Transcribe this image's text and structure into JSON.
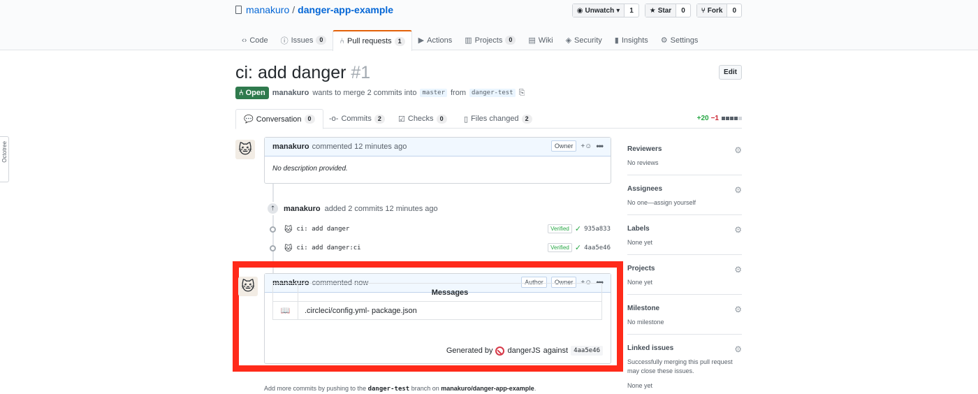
{
  "repo": {
    "owner": "manakuro",
    "separator": "/",
    "name": "danger-app-example"
  },
  "repo_actions": [
    {
      "label": "Unwatch",
      "icon": "eye-icon",
      "count": "1"
    },
    {
      "label": "Star",
      "icon": "star-icon",
      "count": "0"
    },
    {
      "label": "Fork",
      "icon": "fork-icon",
      "count": "0"
    }
  ],
  "repo_nav": [
    {
      "label": "Code",
      "icon": "code-icon",
      "count": ""
    },
    {
      "label": "Issues",
      "icon": "issue-icon",
      "count": "0"
    },
    {
      "label": "Pull requests",
      "icon": "pull-request-icon",
      "count": "1",
      "active": true
    },
    {
      "label": "Actions",
      "icon": "play-icon",
      "count": ""
    },
    {
      "label": "Projects",
      "icon": "project-icon",
      "count": "0"
    },
    {
      "label": "Wiki",
      "icon": "book-icon",
      "count": ""
    },
    {
      "label": "Security",
      "icon": "shield-icon",
      "count": ""
    },
    {
      "label": "Insights",
      "icon": "graph-icon",
      "count": ""
    },
    {
      "label": "Settings",
      "icon": "gear-icon",
      "count": ""
    }
  ],
  "pr": {
    "title": "ci: add danger",
    "number": "#1",
    "edit_label": "Edit",
    "state": "Open",
    "author": "manakuro",
    "merge_text": "wants to merge 2 commits into",
    "base": "master",
    "from_text": "from",
    "head": "danger-test"
  },
  "pr_tabs": [
    {
      "label": "Conversation",
      "count": "0",
      "icon": "comment-icon",
      "active": true
    },
    {
      "label": "Commits",
      "count": "2",
      "icon": "commit-icon"
    },
    {
      "label": "Checks",
      "count": "0",
      "icon": "checklist-icon"
    },
    {
      "label": "Files changed",
      "count": "2",
      "icon": "file-diff-icon"
    }
  ],
  "diffstat": {
    "additions": "+20",
    "deletions": "−1"
  },
  "outline_label": "Octotree",
  "comment1": {
    "author": "manakuro",
    "action": "commented 12 minutes ago",
    "role": "Owner",
    "body": "No description provided."
  },
  "commits_event": {
    "author": "manakuro",
    "text": "added 2 commits 12 minutes ago",
    "commits": [
      {
        "message": "ci: add danger",
        "verified": "Verified",
        "sha": "935a833"
      },
      {
        "message": "ci: add danger:ci",
        "verified": "Verified",
        "sha": "4aa5e46"
      }
    ]
  },
  "comment2": {
    "author": "manakuro",
    "action": "commented now",
    "author_badge": "Author",
    "role": "Owner",
    "table_header": "Messages",
    "message": ".circleci/config.yml- package.json",
    "generated_by": "Generated by",
    "tool": "dangerJS",
    "against": "against",
    "sha": "4aa5e46"
  },
  "footer": {
    "prefix": "Add more commits by pushing to the",
    "branch": "danger-test",
    "middle": "branch on",
    "repo": "manakuro/danger-app-example",
    "suffix": "."
  },
  "sidebar": [
    {
      "title": "Reviewers",
      "value": "No reviews"
    },
    {
      "title": "Assignees",
      "value": "No one—assign yourself"
    },
    {
      "title": "Labels",
      "value": "None yet"
    },
    {
      "title": "Projects",
      "value": "None yet"
    },
    {
      "title": "Milestone",
      "value": "No milestone"
    },
    {
      "title": "Linked issues",
      "value": "Successfully merging this pull request may close these issues.",
      "value2": "None yet"
    }
  ],
  "colors": {
    "open_badge": "#2f7a4d",
    "highlight": "#ff2a1a",
    "link": "#0366d6",
    "active_tab": "#e36209"
  }
}
